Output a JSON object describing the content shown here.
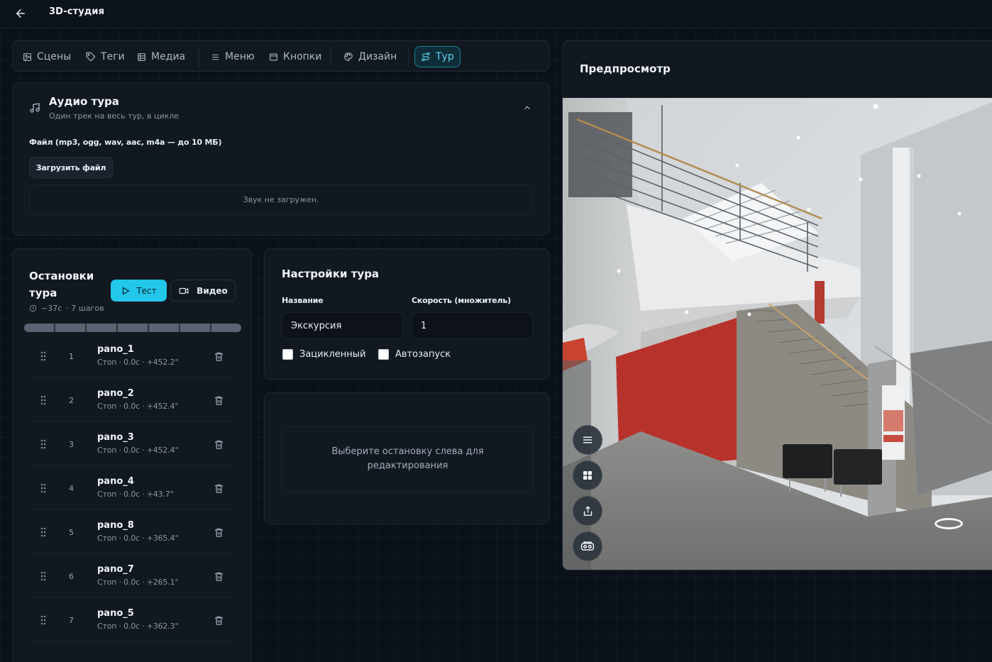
{
  "app": {
    "title": "3D-студия"
  },
  "tabs": [
    {
      "label": "Сцены",
      "icon": "image-icon",
      "active": false
    },
    {
      "label": "Теги",
      "icon": "tag-icon",
      "active": false
    },
    {
      "label": "Медиа",
      "icon": "media-icon",
      "active": false
    },
    {
      "label": "Меню",
      "icon": "menu-icon",
      "active": false
    },
    {
      "label": "Кнопки",
      "icon": "buttons-icon",
      "active": false
    },
    {
      "label": "Дизайн",
      "icon": "palette-icon",
      "active": false
    },
    {
      "label": "Тур",
      "icon": "route-icon",
      "active": true
    }
  ],
  "audio": {
    "title": "Аудио тура",
    "subtitle": "Один трек на весь тур, в цикле",
    "file_label": "Файл (mp3, ogg, wav, aac, m4a — до 10 МБ)",
    "upload_label": "Загрузить файл",
    "empty_text": "Звук не загружен."
  },
  "stops": {
    "title": "Остановки тура",
    "test_label": "Тест",
    "video_label": "Видео",
    "duration": "~37с",
    "steps": "· 7 шагов",
    "items": [
      {
        "num": "1",
        "name": "pano_1",
        "detail": "Стоп · 0.0с · +452.2°"
      },
      {
        "num": "2",
        "name": "pano_2",
        "detail": "Стоп · 0.0с · +452.4°"
      },
      {
        "num": "3",
        "name": "pano_3",
        "detail": "Стоп · 0.0с · +452.4°"
      },
      {
        "num": "4",
        "name": "pano_4",
        "detail": "Стоп · 0.0с · +43.7°"
      },
      {
        "num": "5",
        "name": "pano_8",
        "detail": "Стоп · 0.0с · +365.4°"
      },
      {
        "num": "6",
        "name": "pano_7",
        "detail": "Стоп · 0.0с · +265.1°"
      },
      {
        "num": "7",
        "name": "pano_5",
        "detail": "Стоп · 0.0с · +362.3°"
      }
    ]
  },
  "settings": {
    "title": "Настройки тура",
    "name_label": "Название",
    "name_value": "Экскурсия",
    "speed_label": "Скорость (множитель)",
    "speed_value": "1",
    "loop_label": "Зацикленный",
    "loop_checked": false,
    "autostart_label": "Автозапуск",
    "autostart_checked": false
  },
  "editor": {
    "hint": "Выберите остановку слева для редактирования"
  },
  "preview": {
    "title": "Предпросмотр",
    "buttons": [
      "menu-icon",
      "grid-icon",
      "share-icon",
      "vr-icon"
    ]
  },
  "colors": {
    "accent": "#22c7ea",
    "background": "#0b1118",
    "panel": "#111820"
  }
}
